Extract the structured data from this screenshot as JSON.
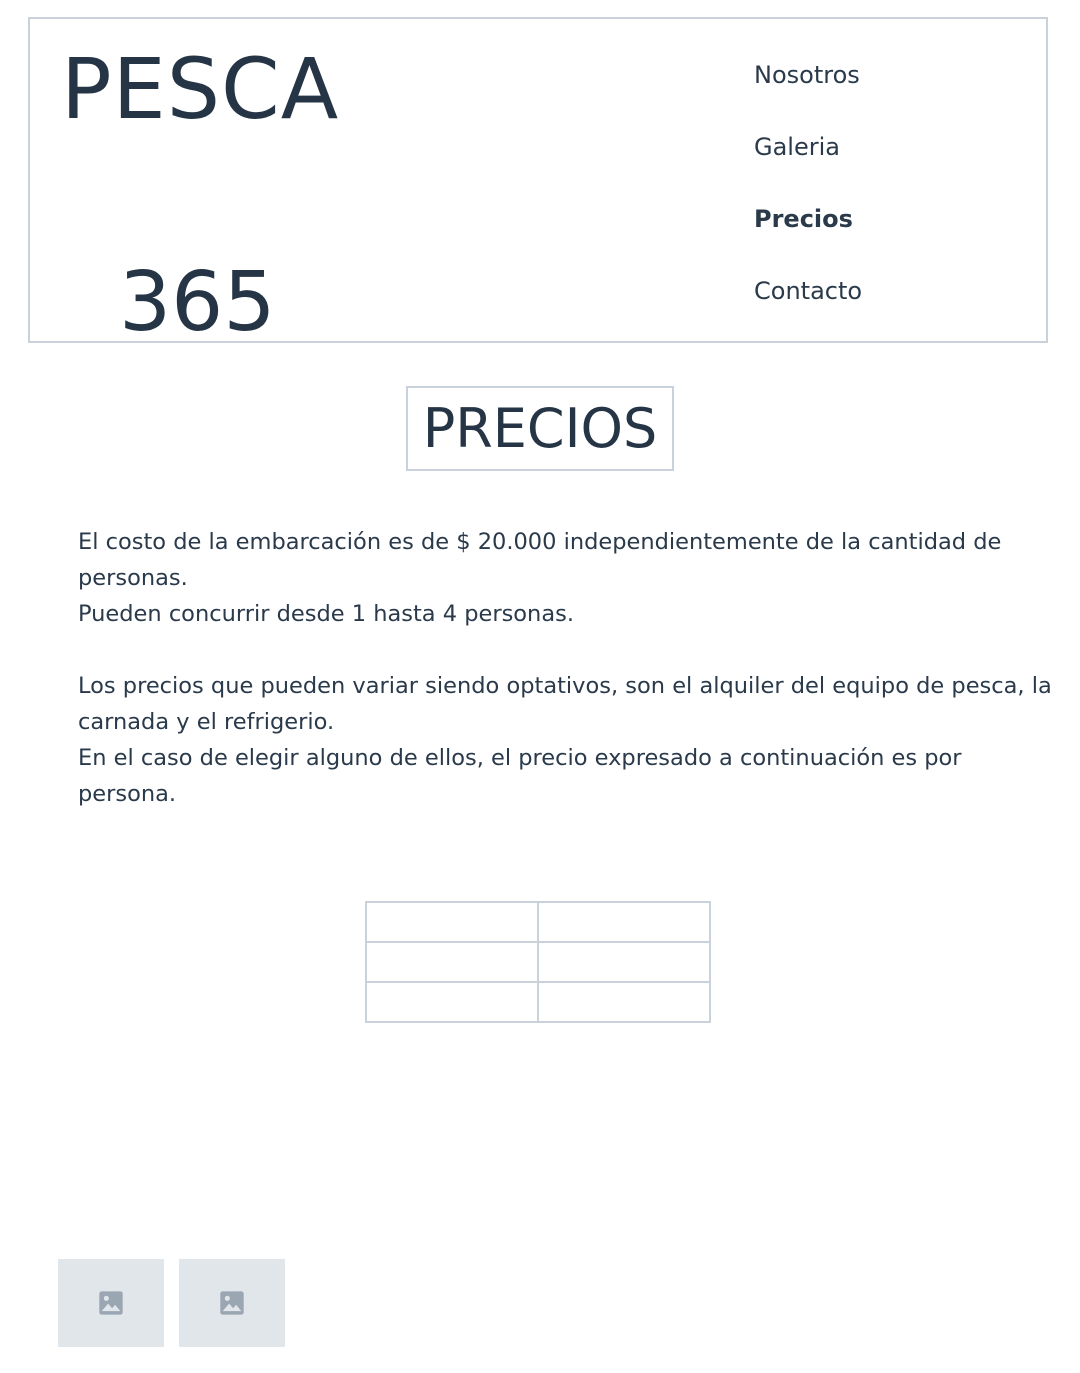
{
  "header": {
    "logo_top": "PESCA",
    "logo_bottom": "365",
    "nav": [
      {
        "label": "Nosotros",
        "active": false
      },
      {
        "label": "Galeria",
        "active": false
      },
      {
        "label": "Precios",
        "active": true
      },
      {
        "label": "Contacto",
        "active": false
      }
    ]
  },
  "main": {
    "title": "PRECIOS",
    "paragraphs": [
      "El costo de la embarcación es de $ 20.000 independientemente de la cantidad de personas.",
      "Pueden concurrir desde 1 hasta 4 personas.",
      "Los precios que pueden variar siendo optativos, son el alquiler del equipo de pesca, la carnada y el refrigerio.",
      "En el caso de elegir alguno de ellos, el precio expresado a continuación es por persona."
    ],
    "table": {
      "rows": [
        [
          "",
          ""
        ],
        [
          "",
          ""
        ],
        [
          "",
          ""
        ]
      ]
    }
  },
  "gallery": {
    "thumbnails": [
      {
        "icon": "image-icon"
      },
      {
        "icon": "image-icon"
      }
    ]
  },
  "colors": {
    "text": "#2a3a4b",
    "border": "#c9d2da",
    "placeholder_bg": "#e1e6eb",
    "placeholder_icon": "#9aa6b2"
  }
}
